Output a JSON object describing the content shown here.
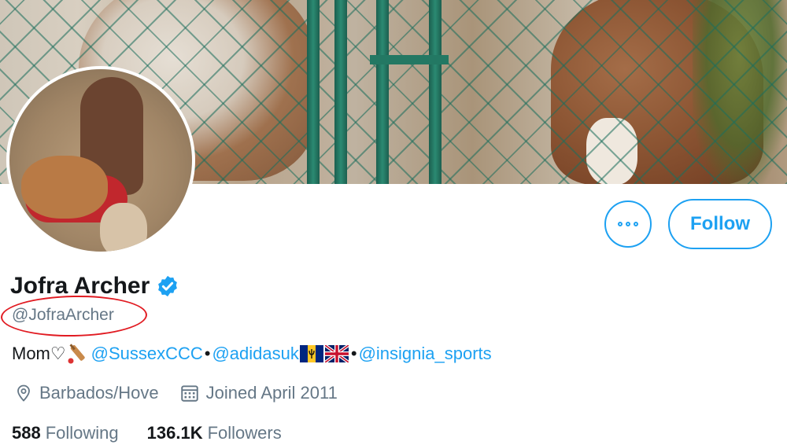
{
  "profile": {
    "display_name": "Jofra Archer",
    "handle": "@JofraArcher",
    "verified": true,
    "bio": {
      "prefix": "Mom♡",
      "cricket_icon": "cricket-bat-icon",
      "mention_1": "@SussexCCC",
      "separator": "•",
      "mention_2": "@adidasuk",
      "flag_1": "barbados-flag-icon",
      "flag_2": "uk-flag-icon",
      "mention_3": "@insignia_sports"
    },
    "location": "Barbados/Hove",
    "joined": "Joined April 2011",
    "following_count": "588",
    "following_label": "Following",
    "followers_count": "136.1K",
    "followers_label": "Followers"
  },
  "actions": {
    "more_icon": "more-options-icon",
    "follow_label": "Follow"
  },
  "colors": {
    "accent": "#1da1f2",
    "secondary_text": "#657786",
    "annotation": "#e11b22"
  }
}
